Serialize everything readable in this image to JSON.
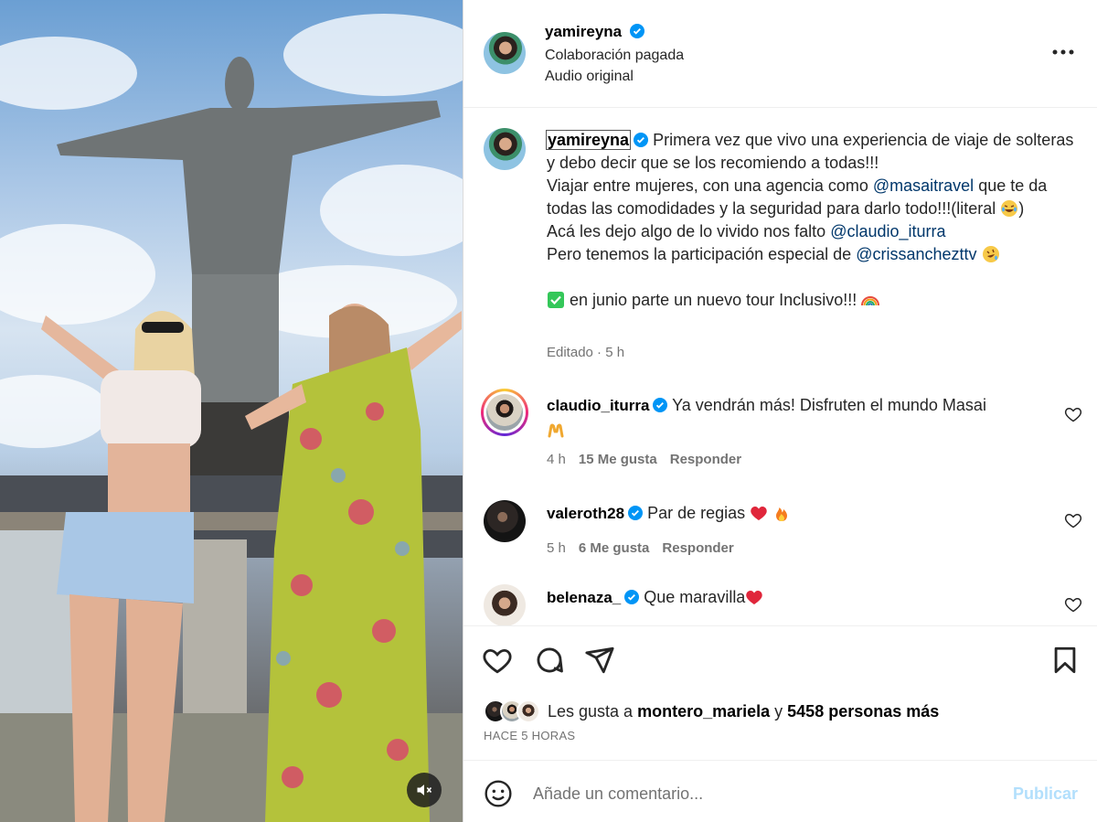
{
  "post": {
    "author": "yamireyna",
    "paid_label": "Colaboración pagada",
    "audio_label": "Audio original",
    "media_alt_icon": "speaker-muted-icon"
  },
  "caption": {
    "username": "yamireyna",
    "line1": "Primera vez que vivo una experiencia de viaje de solteras y debo decir que se los recomiendo a todas!!!",
    "line2_pre": "Viajar entre mujeres, con una agencia como ",
    "mention1": "@masaitravel",
    "line2_post": " que te da todas las comodidades y la seguridad para darlo todo!!!(literal ",
    "line2_end": ")",
    "line3_pre": "Acá les dejo algo de lo vivido nos falto ",
    "mention2": "@claudio_iturra",
    "line4_pre": "Pero tenemos la participación especial de ",
    "mention3": "@crissanchezttv",
    "line5": " en junio parte un nuevo tour Inclusivo!!! ",
    "meta": "Editado · 5 h"
  },
  "comments": [
    {
      "username": "claudio_iturra",
      "text": "Ya vendrán más! Disfruten el mundo Masai",
      "time": "4 h",
      "likes": "15 Me gusta",
      "reply": "Responder"
    },
    {
      "username": "valeroth28",
      "text": "Par de regias",
      "time": "5 h",
      "likes": "6 Me gusta",
      "reply": "Responder"
    },
    {
      "username": "belenaza_",
      "text": "Que maravilla"
    }
  ],
  "engagement": {
    "likes_prefix": "Les gusta a ",
    "liked_by": "montero_mariela",
    "likes_mid": " y ",
    "others": "5458 personas más",
    "time_ago": "HACE 5 HORAS"
  },
  "composer": {
    "placeholder": "Añade un comentario...",
    "publish": "Publicar"
  },
  "colors": {
    "link": "#00376b",
    "verified": "#0095f6",
    "publish_disabled": "#b2dffc",
    "muted_text": "#737373"
  },
  "icons": [
    "verified-badge-icon",
    "more-options-icon",
    "heart-icon",
    "comment-icon",
    "share-icon",
    "bookmark-icon",
    "emoji-icon",
    "speaker-muted-icon"
  ]
}
